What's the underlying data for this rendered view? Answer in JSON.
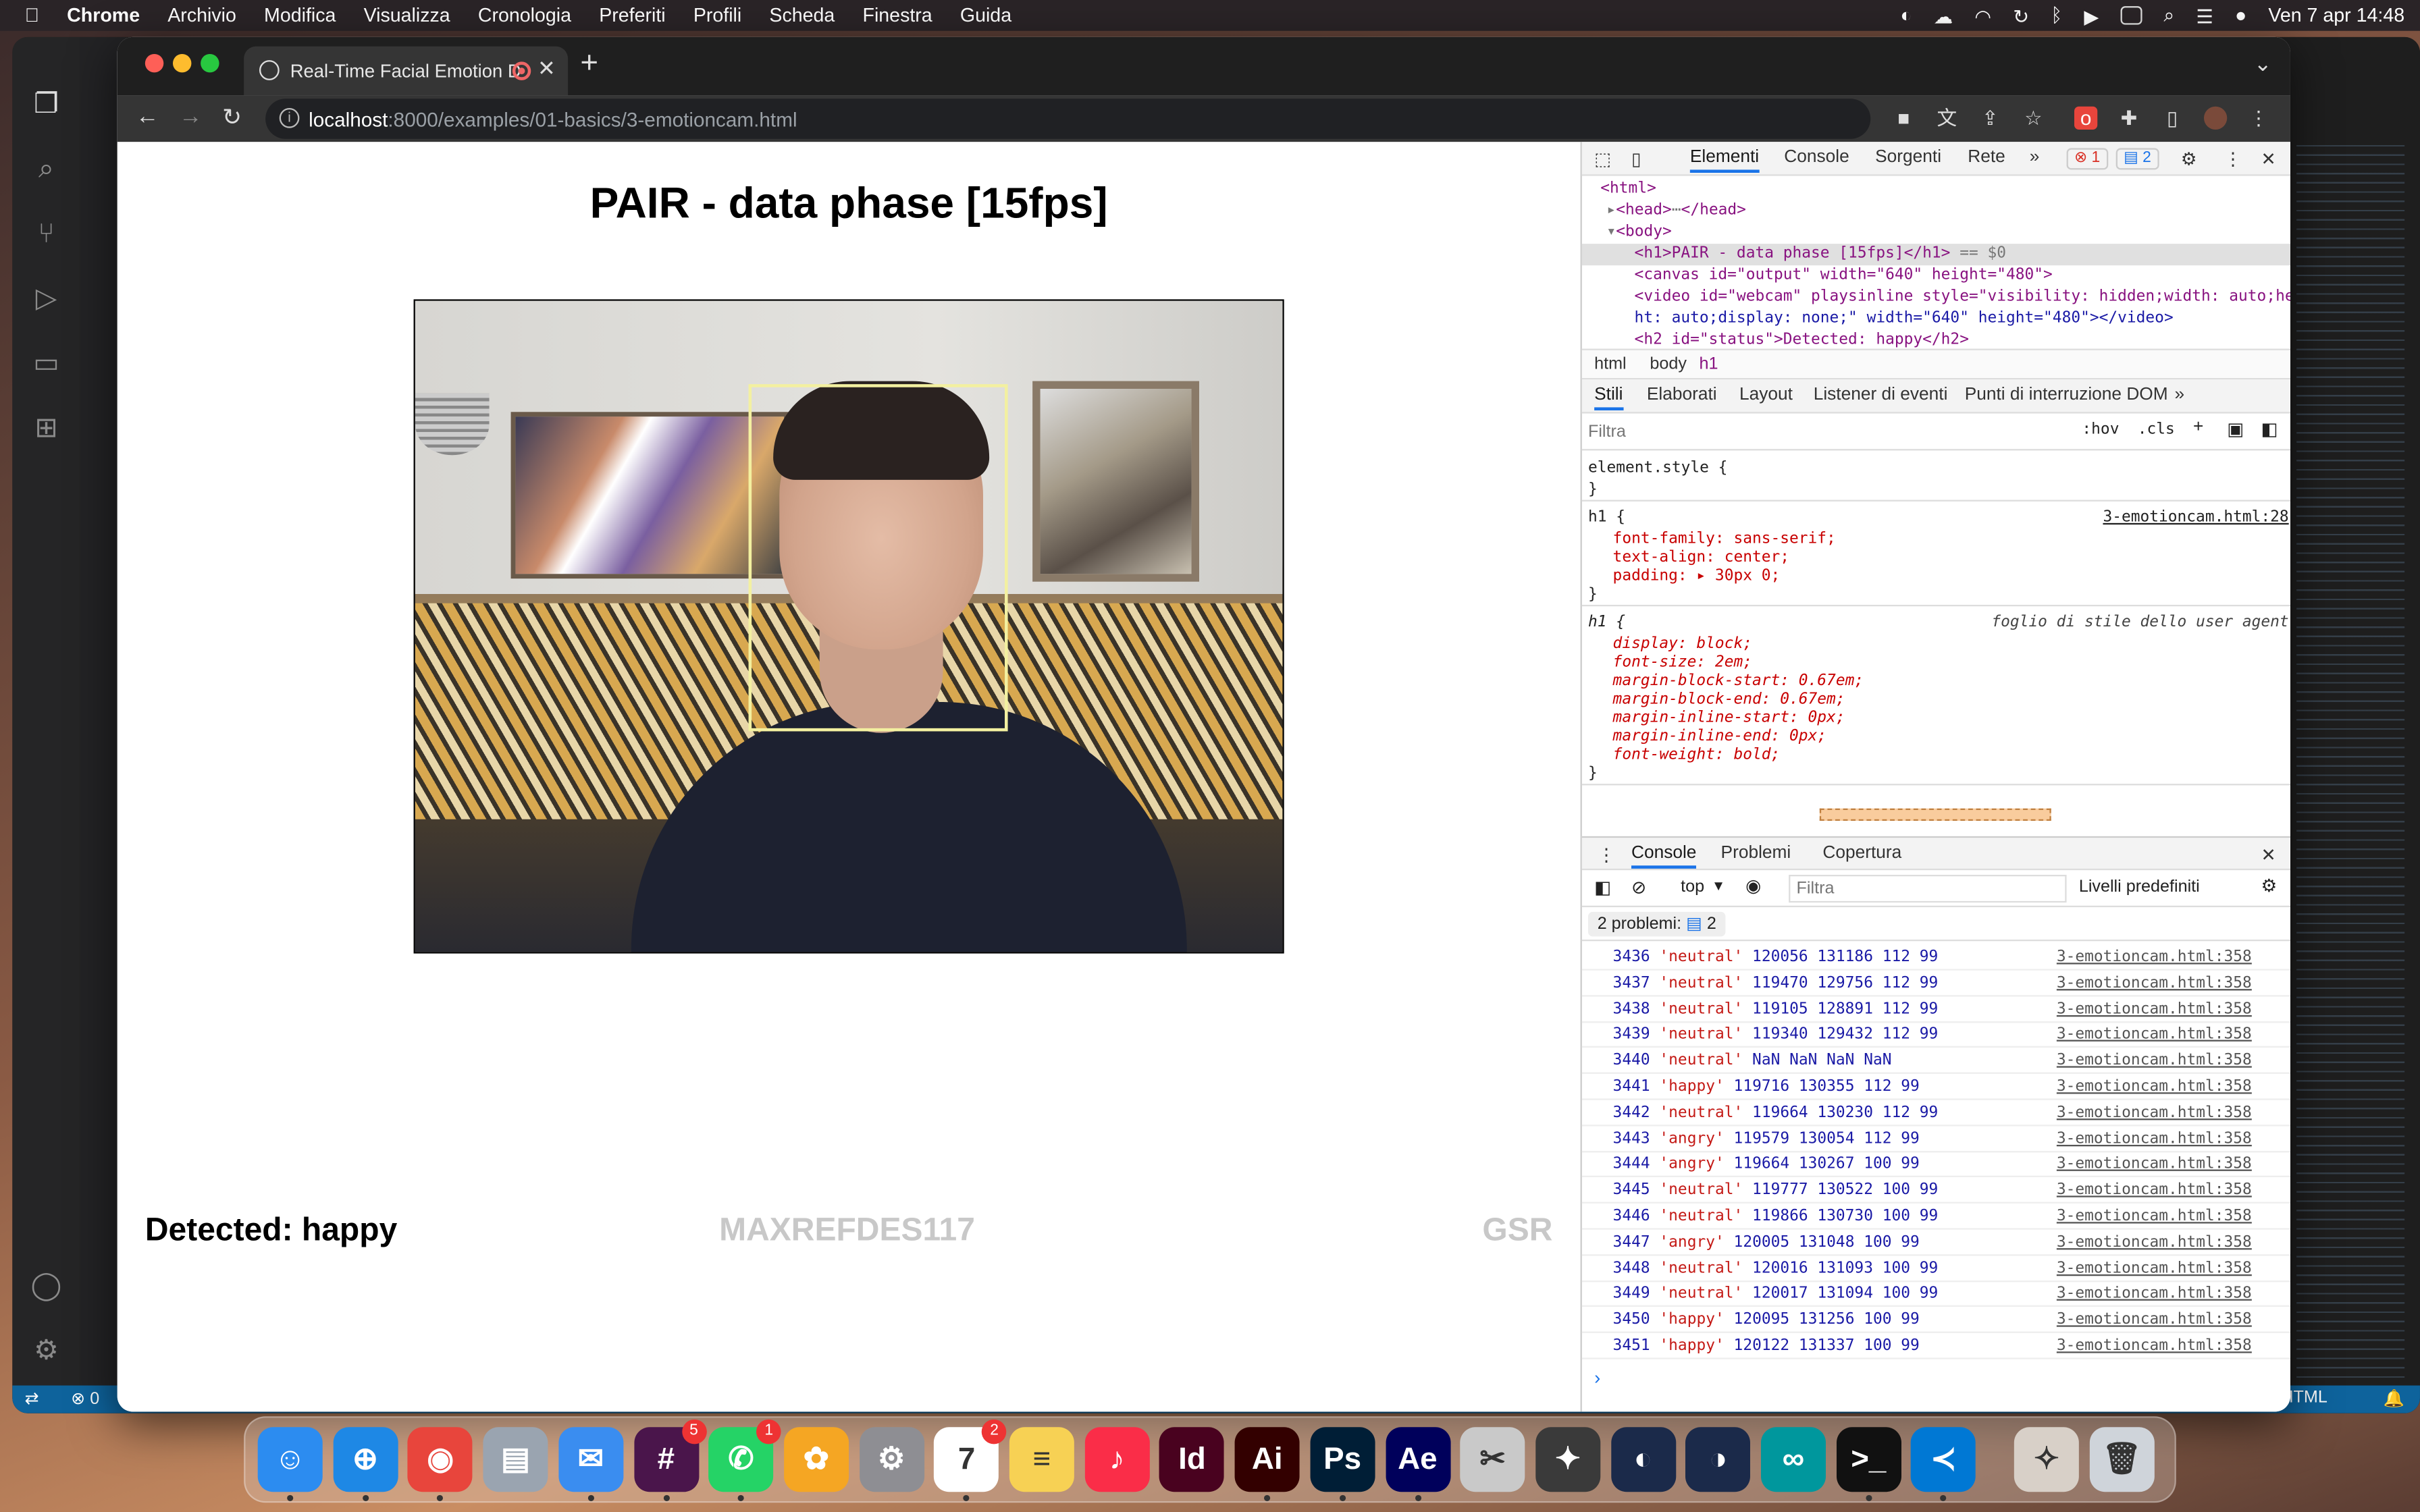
{
  "menubar": {
    "app": "Chrome",
    "items": [
      "Archivio",
      "Modifica",
      "Visualizza",
      "Cronologia",
      "Preferiti",
      "Profili",
      "Scheda",
      "Finestra",
      "Guida"
    ],
    "clock": "Ven 7 apr  14:48"
  },
  "browser": {
    "tab_title": "Real-Time Facial Emotion D",
    "url_host": "localhost",
    "url_path": ":8000/examples/01-basics/3-emotioncam.html"
  },
  "page": {
    "title": "PAIR - data phase [15fps]",
    "status": "Detected: happy",
    "sensor_label": "MAXREFDES117",
    "gsr_label": "GSR"
  },
  "devtools": {
    "tabs": [
      "Elementi",
      "Console",
      "Sorgenti",
      "Rete"
    ],
    "errors": "1",
    "messages": "2",
    "dom": [
      "<html>",
      "<head>",
      "</head>",
      "<body>",
      "<h1>PAIR - data phase [15fps]</h1>",
      "== $0",
      "<canvas id=\"output\" width=\"640\" height=\"480\">",
      "<video id=\"webcam\" playsinline style=\"visibility: hidden;width: auto;heig",
      "ht: auto;display: none;\" width=\"640\" height=\"480\"></video>",
      "<h2 id=\"status\">Detected: happy</h2>"
    ],
    "breadcrumbs": [
      "html",
      "body",
      "h1"
    ],
    "subtabs": [
      "Stili",
      "Elaborati",
      "Layout",
      "Listener di eventi",
      "Punti di interruzione DOM"
    ],
    "filter_placeholder": "Filtra",
    "hov": ":hov",
    "cls": ".cls",
    "styles": {
      "element_style": "element.style {",
      "close": "}",
      "rule1_selector": "h1 {",
      "rule1_source": "3-emotioncam.html:28",
      "rule1_props": [
        "font-family: sans-serif;",
        "text-align: center;",
        "padding: ▸ 30px 0;"
      ],
      "rule2_selector": "h1 {",
      "rule2_source": "foglio di stile dello user agent",
      "rule2_props": [
        "display: block;",
        "font-size: 2em;",
        "margin-block-start: 0.67em;",
        "margin-block-end: 0.67em;",
        "margin-inline-start: 0px;",
        "margin-inline-end: 0px;",
        "font-weight: bold;"
      ]
    },
    "drawer_tabs": [
      "Console",
      "Problemi",
      "Copertura"
    ],
    "context": "top",
    "console_filter": "Filtra",
    "levels": "Livelli predefiniti",
    "problems": "2 problemi:",
    "problems_count": "2",
    "log_source": "3-emotioncam.html:358",
    "logs": [
      {
        "n": "3436",
        "e": "'neutral'",
        "v": "120056 131186 112 99"
      },
      {
        "n": "3437",
        "e": "'neutral'",
        "v": "119470 129756 112 99"
      },
      {
        "n": "3438",
        "e": "'neutral'",
        "v": "119105 128891 112 99"
      },
      {
        "n": "3439",
        "e": "'neutral'",
        "v": "119340 129432 112 99"
      },
      {
        "n": "3440",
        "e": "'neutral'",
        "v": "NaN NaN NaN NaN"
      },
      {
        "n": "3441",
        "e": "'happy'",
        "v": "119716 130355 112 99"
      },
      {
        "n": "3442",
        "e": "'neutral'",
        "v": "119664 130230 112 99"
      },
      {
        "n": "3443",
        "e": "'angry'",
        "v": "119579 130054 112 99"
      },
      {
        "n": "3444",
        "e": "'angry'",
        "v": "119664 130267 100 99"
      },
      {
        "n": "3445",
        "e": "'neutral'",
        "v": "119777 130522 100 99"
      },
      {
        "n": "3446",
        "e": "'neutral'",
        "v": "119866 130730 100 99"
      },
      {
        "n": "3447",
        "e": "'angry'",
        "v": "120005 131048 100 99"
      },
      {
        "n": "3448",
        "e": "'neutral'",
        "v": "120016 131093 100 99"
      },
      {
        "n": "3449",
        "e": "'neutral'",
        "v": "120017 131094 100 99"
      },
      {
        "n": "3450",
        "e": "'happy'",
        "v": "120095 131256 100 99"
      },
      {
        "n": "3451",
        "e": "'happy'",
        "v": "120122 131337 100 99"
      }
    ]
  },
  "vscode": {
    "status_errors": "⊗ 0",
    "status_lang": "HTML"
  },
  "dock": {
    "apps": [
      {
        "name": "Finder",
        "label": "☺",
        "color": "#2c8cf0"
      },
      {
        "name": "Safari",
        "label": "⊕",
        "color": "#1e88e5"
      },
      {
        "name": "Chrome",
        "label": "◉",
        "color": "#e8453c"
      },
      {
        "name": "Preview",
        "label": "▤",
        "color": "#9aa4b0"
      },
      {
        "name": "Mail",
        "label": "✉",
        "color": "#3a8df0"
      },
      {
        "name": "Slack",
        "label": "#",
        "color": "#4a154b",
        "badge": "5"
      },
      {
        "name": "WhatsApp",
        "label": "✆",
        "color": "#25d366",
        "badge": "1"
      },
      {
        "name": "Photos",
        "label": "✿",
        "color": "#f5a623"
      },
      {
        "name": "System Settings",
        "label": "⚙",
        "color": "#8e8e93"
      },
      {
        "name": "Calendar",
        "label": "7",
        "color": "#ffffff",
        "badge": "2"
      },
      {
        "name": "Notes",
        "label": "≡",
        "color": "#f7d154"
      },
      {
        "name": "Music",
        "label": "♪",
        "color": "#fa2d48"
      },
      {
        "name": "InDesign",
        "label": "Id",
        "color": "#49021f"
      },
      {
        "name": "Illustrator",
        "label": "Ai",
        "color": "#330000"
      },
      {
        "name": "Photoshop",
        "label": "Ps",
        "color": "#001e36"
      },
      {
        "name": "After Effects",
        "label": "Ae",
        "color": "#00005b"
      },
      {
        "name": "Preview Tool",
        "label": "✂",
        "color": "#c9c9c9"
      },
      {
        "name": "DaVinci",
        "label": "✦",
        "color": "#3a3a3a"
      },
      {
        "name": "Cinema 4D",
        "label": "◐",
        "color": "#1b2a4a"
      },
      {
        "name": "Cinema 4D 2",
        "label": "◑",
        "color": "#1b2a4a"
      },
      {
        "name": "Arduino",
        "label": "∞",
        "color": "#00979d"
      },
      {
        "name": "Terminal",
        "label": ">_",
        "color": "#111111"
      },
      {
        "name": "VS Code",
        "label": "≺",
        "color": "#0078d4"
      },
      {
        "name": "Compass",
        "label": "✧",
        "color": "#d8d0c8"
      },
      {
        "name": "Trash",
        "label": "🗑",
        "color": "#cfd4da"
      }
    ]
  }
}
